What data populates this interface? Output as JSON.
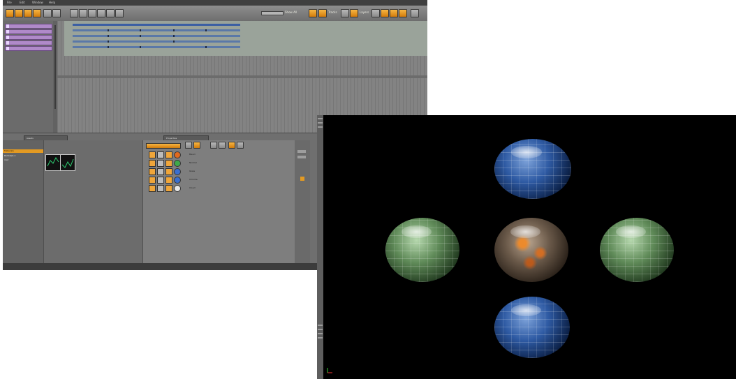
{
  "editor": {
    "menu": [
      "File",
      "Edit",
      "Window",
      "Help"
    ],
    "toolbar_labels": [
      "Show All",
      "Tracks",
      "Layers"
    ],
    "tracks": [
      "",
      "",
      "",
      "",
      ""
    ],
    "timeline_status": "",
    "bottom_tabs": [
      "Assets",
      "Properties"
    ],
    "assets": [
      "Materials",
      "BeitoSph-1",
      "mat"
    ],
    "properties": [
      {
        "label": "Blend"
      },
      {
        "label": "Normal"
      },
      {
        "label": "Glass"
      },
      {
        "label": "Chrome"
      },
      {
        "label": "Cloud"
      }
    ],
    "status": {
      "left": "",
      "left2": "",
      "right": ""
    }
  },
  "render": {
    "spheres": [
      {
        "material": "blue-tile"
      },
      {
        "material": "green-tile"
      },
      {
        "material": "lava-rock"
      },
      {
        "material": "green-tile"
      },
      {
        "material": "blue-tile"
      }
    ]
  },
  "colors": {
    "accent_orange": "#e39a22",
    "track_purple": "#b08ac9",
    "editor_bg": "#7c7c7c",
    "render_bg": "#000000"
  }
}
